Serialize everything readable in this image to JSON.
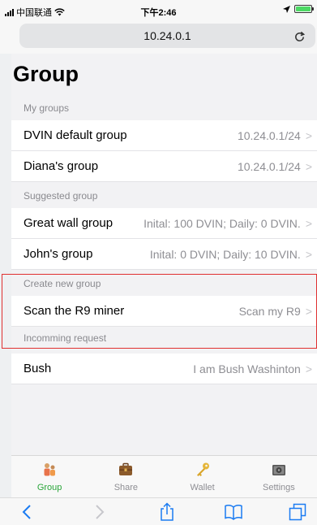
{
  "status_bar": {
    "carrier": "中国联通",
    "time": "下午2:46"
  },
  "url_bar": {
    "url": "10.24.0.1"
  },
  "page": {
    "title": "Group"
  },
  "sections": {
    "my_groups": {
      "header": "My groups",
      "rows": [
        {
          "label": "DVIN default group",
          "value": "10.24.0.1/24"
        },
        {
          "label": "Diana's group",
          "value": "10.24.0.1/24"
        }
      ]
    },
    "suggested": {
      "header": "Suggested group",
      "rows": [
        {
          "label": "Great wall group",
          "value": "Inital: 100 DVIN; Daily: 0 DVIN."
        },
        {
          "label": "John's group",
          "value": "Inital: 0 DVIN; Daily: 10 DVIN."
        }
      ]
    },
    "create": {
      "header": "Create new group",
      "rows": [
        {
          "label": "Scan the R9 miner",
          "value": "Scan my R9"
        }
      ]
    },
    "incoming": {
      "header": "Incomming request",
      "rows": [
        {
          "label": "Bush",
          "value": "I am Bush Washinton"
        }
      ]
    }
  },
  "tabs": [
    {
      "label": "Group",
      "icon": "group-icon",
      "active": true
    },
    {
      "label": "Share",
      "icon": "briefcase-icon",
      "active": false
    },
    {
      "label": "Wallet",
      "icon": "key-icon",
      "active": false
    },
    {
      "label": "Settings",
      "icon": "miner-icon",
      "active": false
    }
  ],
  "colors": {
    "accent_active_tab": "#2aa53a",
    "highlight_border": "#e03030",
    "safari_blue": "#1a7bf2"
  }
}
